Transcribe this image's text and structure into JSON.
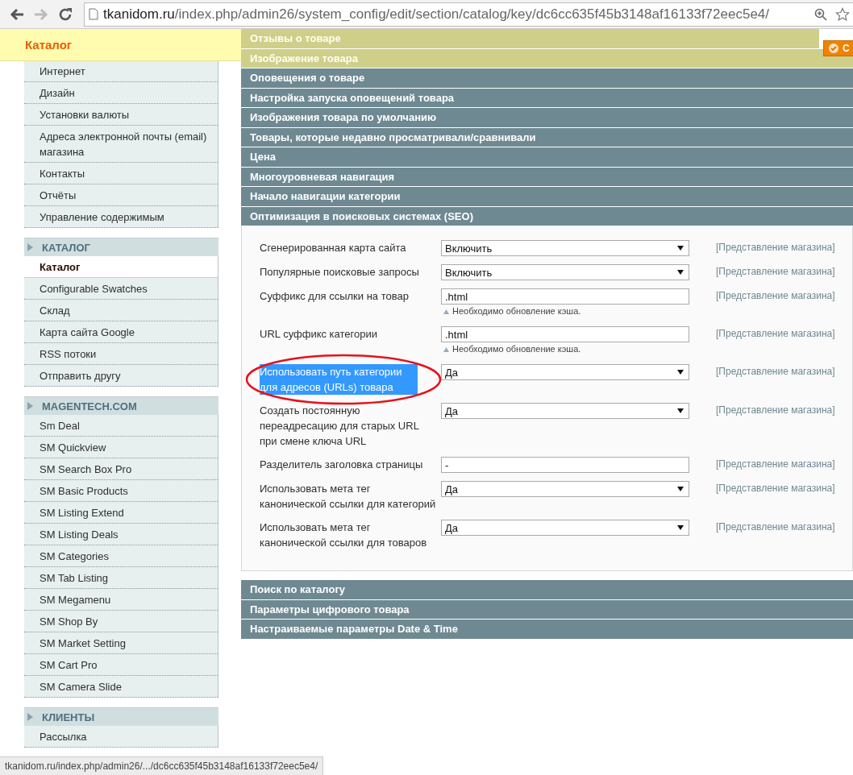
{
  "browser": {
    "url_domain": "tkanidom.ru",
    "url_path": "/index.php/admin26/system_config/edit/section/catalog/key/dc6cc635f45b3148af16133f72eec5e4/"
  },
  "header": {
    "title": "Каталог",
    "button_label": "С"
  },
  "sidebar": {
    "groups": [
      {
        "items": [
          {
            "label": "Интернет",
            "selected": false
          },
          {
            "label": "Дизайн",
            "selected": false
          },
          {
            "label": "Установки валюты",
            "selected": false
          },
          {
            "label": "Адреса электронной почты (email) магазина",
            "selected": false
          },
          {
            "label": "Контакты",
            "selected": false
          },
          {
            "label": "Отчёты",
            "selected": false
          },
          {
            "label": "Управление содержимым",
            "selected": false
          }
        ]
      },
      {
        "title": "КАТАЛОГ",
        "items": [
          {
            "label": "Каталог",
            "selected": true
          },
          {
            "label": "Configurable Swatches",
            "selected": false
          },
          {
            "label": "Склад",
            "selected": false
          },
          {
            "label": "Карта сайта Google",
            "selected": false
          },
          {
            "label": "RSS потоки",
            "selected": false
          },
          {
            "label": "Отправить другу",
            "selected": false
          }
        ]
      },
      {
        "title": "MAGENTECH.COM",
        "items": [
          {
            "label": "Sm Deal",
            "selected": false
          },
          {
            "label": "SM Quickview",
            "selected": false
          },
          {
            "label": "SM Search Box Pro",
            "selected": false
          },
          {
            "label": "SM Basic Products",
            "selected": false
          },
          {
            "label": "SM Listing Extend",
            "selected": false
          },
          {
            "label": "SM Listing Deals",
            "selected": false
          },
          {
            "label": "SM Categories",
            "selected": false
          },
          {
            "label": "SM Tab Listing",
            "selected": false
          },
          {
            "label": "SM Megamenu",
            "selected": false
          },
          {
            "label": "SM Shop By",
            "selected": false
          },
          {
            "label": "SM Market Setting",
            "selected": false
          },
          {
            "label": "SM Cart Pro",
            "selected": false
          },
          {
            "label": "SM Camera Slide",
            "selected": false
          }
        ]
      },
      {
        "title": "КЛИЕНТЫ",
        "items": [
          {
            "label": "Рассылка",
            "selected": false
          }
        ]
      }
    ]
  },
  "sections_before": [
    "Отзывы о товаре",
    "Изображение товара",
    "Оповещения о товаре",
    "Настройка запуска оповещений товара",
    "Изображения товара по умолчанию",
    "Товары, которые недавно просматривали/сравнивали",
    "Цена",
    "Многоуровневая навигация",
    "Начало навигации категории"
  ],
  "open_section": {
    "title": "Оптимизация в поисковых системах (SEO)",
    "fields": [
      {
        "label": "Сгенерированная карта сайта",
        "kind": "select",
        "value": "Включить",
        "scope": "[Представление магазина]",
        "highlighted": false
      },
      {
        "label": "Популярные поисковые запросы",
        "kind": "select",
        "value": "Включить",
        "scope": "[Представление магазина]",
        "highlighted": false
      },
      {
        "label": "Суффикс для ссылки на товар",
        "kind": "text",
        "value": ".html",
        "note": "Необходимо обновление кэша.",
        "scope": "[Представление магазина]",
        "highlighted": false
      },
      {
        "label": "URL суффикс категории",
        "kind": "text",
        "value": ".html",
        "note": "Необходимо обновление кэша.",
        "scope": "[Представление магазина]",
        "highlighted": false
      },
      {
        "label": "Использовать путь категории для адресов (URLs) товара",
        "kind": "select",
        "value": "Да",
        "scope": "[Представление магазина]",
        "highlighted": true
      },
      {
        "label": "Создать постоянную переадресацию для старых URL при смене ключа URL",
        "kind": "select",
        "value": "Да",
        "scope": "[Представление магазина]",
        "highlighted": false
      },
      {
        "label": "Разделитель заголовка страницы",
        "kind": "text",
        "value": "-",
        "scope": "[Представление магазина]",
        "highlighted": false
      },
      {
        "label": "Использовать мета тег канонической ссылки для категорий",
        "kind": "select",
        "value": "Да",
        "scope": "[Представление магазина]",
        "highlighted": false
      },
      {
        "label": "Использовать мета тег канонической ссылки для товаров",
        "kind": "select",
        "value": "Да",
        "scope": "[Представление магазина]",
        "highlighted": false
      }
    ]
  },
  "sections_after": [
    "Поиск по каталогу",
    "Параметры цифрового товара",
    "Настраиваемые параметры Date & Time"
  ],
  "status_bar": "tkanidom.ru/index.php/admin26/.../dc6cc635f45b3148af16133f72eec5e4/"
}
